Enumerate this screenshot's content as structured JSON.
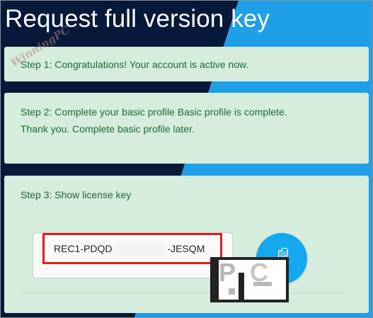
{
  "page": {
    "title": "Request full version key"
  },
  "steps": {
    "step1": {
      "label": "Step 1: Congratulations! Your account is active now."
    },
    "step2": {
      "line1": "Step 2: Complete your basic profile Basic profile is complete.",
      "line2": "Thank you. Complete basic profile later."
    },
    "step3": {
      "label": "Step 3: Show license key",
      "key_prefix": "REC1-PDQD",
      "key_suffix": "-JESQM"
    }
  },
  "watermarks": {
    "winning_pc": "WinningPC",
    "logo": "PC"
  },
  "icons": {
    "copy": "clipboard-check-icon"
  },
  "colors": {
    "title_bg_dark": "#07193a",
    "title_bg_blue": "#1e9fe7",
    "card_bg": "#d6ecdc",
    "card_text": "#1f6a35",
    "copy_button": "#14a8ef",
    "highlight_border": "#d62020"
  }
}
